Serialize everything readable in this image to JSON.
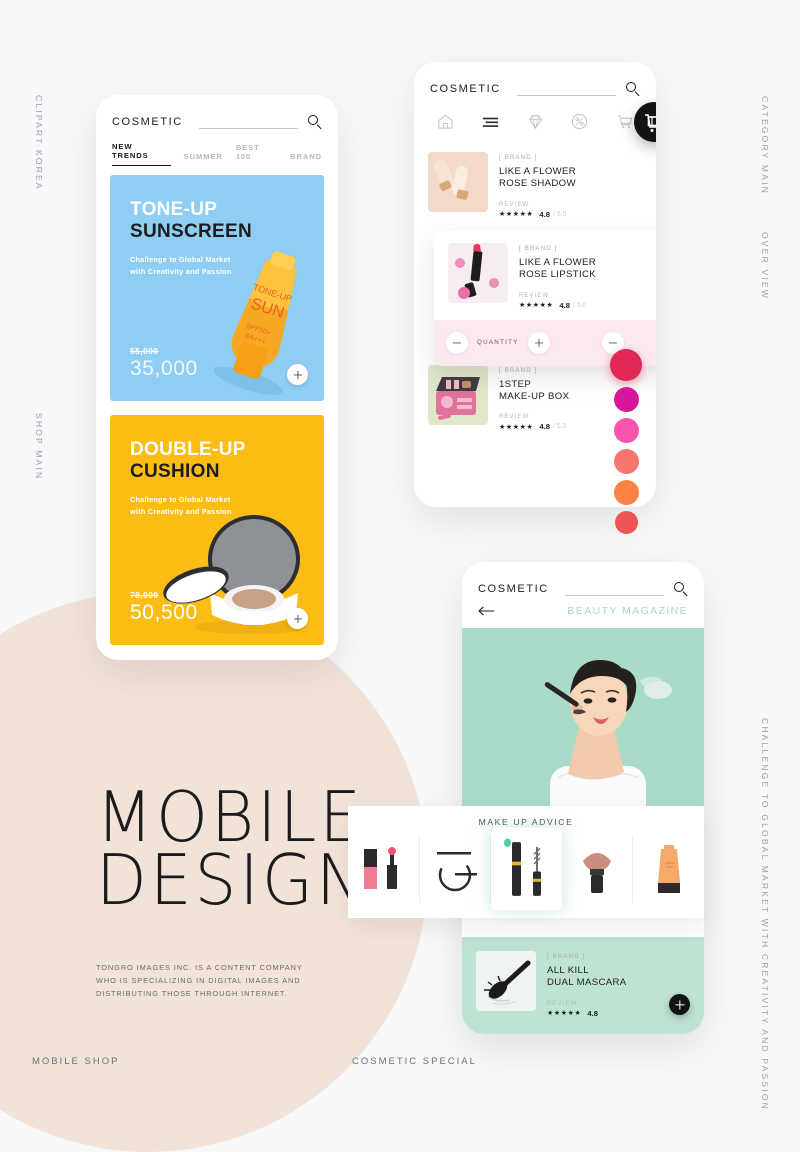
{
  "poster": {
    "headline_line1": "MOBILE",
    "headline_line2": "DESIGN",
    "blurb": "TONGRO IMAGES INC. IS A CONTENT COMPANY WHO IS SPECIALIZING IN DIGITAL IMAGES AND DISTRIBUTING THOSE THROUGH INTERNET.",
    "side_labels": {
      "left_top": "CLIPART KOREA",
      "left_mid": "SHOP MAIN",
      "right_top": "CATEGORY MAIN",
      "right_mid": "OVER VIEW",
      "right_long": "CHALLENGE TO GLOBAL MARKET WITH CREATIVITY AND PASSION"
    },
    "footer_left": "MOBILE SHOP",
    "footer_center": "COSMETIC SPECIAL",
    "colors": {
      "background": "#f7f8f9",
      "circle": "#f2e3d9",
      "promo_blue": "#8fcdf2",
      "promo_yellow": "#fbbd14",
      "mint": "#bfe3d3",
      "pink_bar": "#fce9f0"
    }
  },
  "phone1": {
    "brand": "COSMETIC",
    "search_placeholder": "",
    "tabs": [
      {
        "label": "NEW TRENDS",
        "active": true
      },
      {
        "label": "SUMMER",
        "active": false
      },
      {
        "label": "BEST 100",
        "active": false
      },
      {
        "label": "BRAND",
        "active": false
      }
    ],
    "promos": [
      {
        "title_line1": "TONE-UP",
        "title_line2": "SUNSCREEN",
        "subtitle_line1": "Challenge to Global Market",
        "subtitle_line2": "with Creativity and Passion",
        "price_old": "55,000",
        "price_now": "35,000",
        "add_label": "+",
        "product_text_line1": "TONE-UP",
        "product_text_line2": "SUN",
        "product_text_line3": "SPF50+",
        "product_text_line4": "PA+++"
      },
      {
        "title_line1": "DOUBLE-UP",
        "title_line2": "CUSHION",
        "subtitle_line1": "Challenge to Global Market",
        "subtitle_line2": "with Creativity and Passion",
        "price_old": "78,000",
        "price_now": "50,500",
        "add_label": "+"
      }
    ]
  },
  "phone2": {
    "brand": "COSMETIC",
    "nav_icons": [
      "home-icon",
      "menu-icon",
      "diamond-icon",
      "percent-icon",
      "cart-icon"
    ],
    "products": [
      {
        "brand": "[ BRAND ]",
        "name_line1": "LIKE A FLOWER",
        "name_line2": "ROSE SHADOW",
        "review_label": "REVIEW",
        "stars": "★★★★★",
        "score": "4.8",
        "outof": "/ 5.0"
      },
      {
        "brand": "[ BRAND ]",
        "name_line1": "LIKE A FLOWER",
        "name_line2": "ROSE LIPSTICK",
        "review_label": "REVIEW",
        "stars": "★★★★★",
        "score": "4.8",
        "outof": "/ 5.0",
        "quantity_label": "QUANTITY",
        "minus_label": "−",
        "plus_label": "+",
        "cart_label": "cart"
      },
      {
        "brand": "[ BRAND ]",
        "name_line1": "1STEP",
        "name_line2": "MAKE-UP BOX",
        "review_label": "REVIEW",
        "stars": "★★★★★",
        "score": "4.8",
        "outof": "/ 5.0"
      }
    ],
    "swatches": [
      "#e02755",
      "#d5189a",
      "#fb54b0",
      "#f9766f",
      "#fb8144",
      "#ef5454"
    ]
  },
  "phone3": {
    "brand": "COSMETIC",
    "section_title": "BEAUTY MAGAZINE",
    "back_label": "←",
    "advice_title": "MAKE UP ADVICE",
    "advice_items": [
      {
        "icon": "lipgloss-icon",
        "selected": false
      },
      {
        "icon": "compact-powder-icon",
        "selected": false
      },
      {
        "icon": "mascara-icon",
        "selected": true
      },
      {
        "icon": "blush-brush-icon",
        "selected": false
      },
      {
        "icon": "foundation-tube-icon",
        "selected": false
      }
    ],
    "product": {
      "brand": "[ BRAND ]",
      "name_line1": "ALL KILL",
      "name_line2": "DUAL MASCARA",
      "review_label": "REVIEW",
      "stars": "★★★★★",
      "score": "4.8",
      "add_label": "+"
    }
  }
}
